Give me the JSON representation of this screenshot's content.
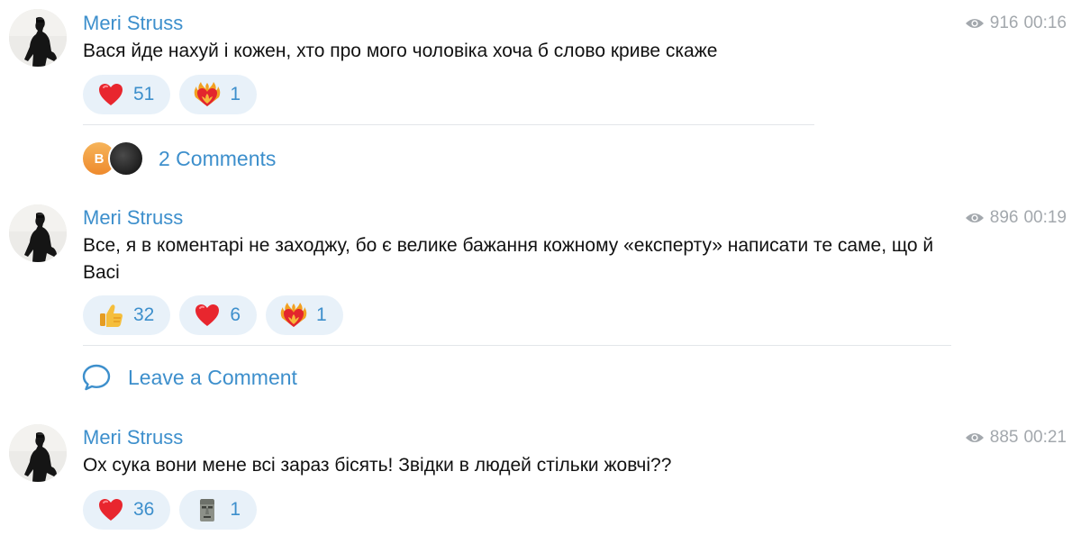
{
  "posts": [
    {
      "author": "Meri Struss",
      "views": "916",
      "time": "00:16",
      "text": "Вася йде нахуй і кожен, хто про мого чоловіка хоча б слово криве скаже",
      "reactions": [
        {
          "icon": "red-heart-icon",
          "count": "51"
        },
        {
          "icon": "heart-on-fire-icon",
          "count": "1"
        }
      ],
      "comments": {
        "avatar_letter": "B",
        "label": "2 Comments"
      }
    },
    {
      "author": "Meri Struss",
      "views": "896",
      "time": "00:19",
      "text": "Все, я в коментарі не заходжу, бо є велике бажання кожному «експерту» написати те саме, що й Васі",
      "reactions": [
        {
          "icon": "thumbs-up-icon",
          "count": "32"
        },
        {
          "icon": "red-heart-icon",
          "count": "6"
        },
        {
          "icon": "heart-on-fire-icon",
          "count": "1"
        }
      ],
      "comments": {
        "label": "Leave a Comment"
      }
    },
    {
      "author": "Meri Struss",
      "views": "885",
      "time": "00:21",
      "text": "Ох сука вони мене всі зараз бісять! Звідки в людей стільки жовчі??",
      "reactions": [
        {
          "icon": "red-heart-icon",
          "count": "36"
        },
        {
          "icon": "moai-icon",
          "count": "1"
        }
      ]
    }
  ],
  "colors": {
    "accent": "#3d8fcc",
    "reaction_bg": "#e8f1f9",
    "meta": "#a3a8ad"
  }
}
